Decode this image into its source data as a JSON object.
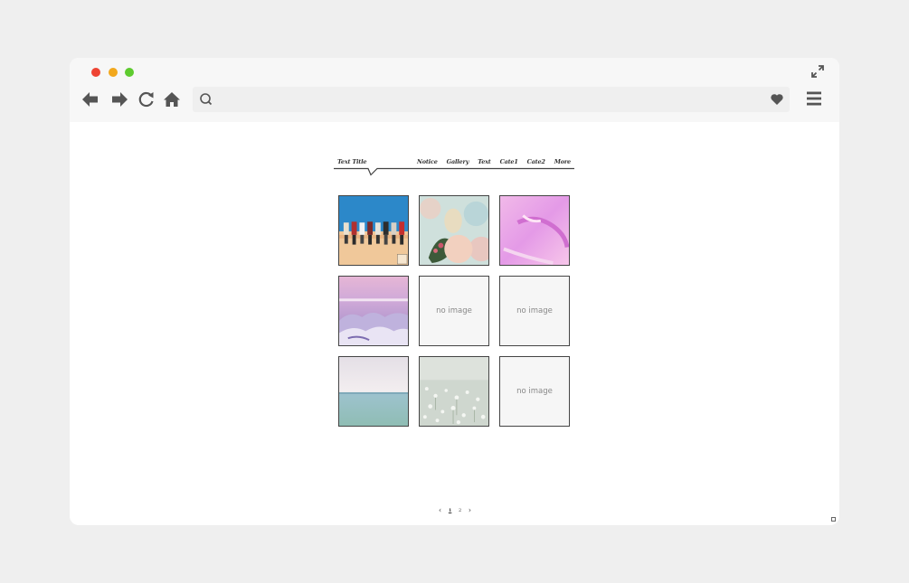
{
  "browser": {
    "window_controls": [
      "close",
      "minimize",
      "zoom"
    ],
    "nav_icons": [
      "back-arrow-icon",
      "forward-arrow-icon",
      "reload-icon",
      "home-icon"
    ],
    "search_icon": "search-icon",
    "favorite_icon": "heart-icon",
    "menu_icon": "hamburger-menu-icon",
    "expand_icon": "expand-icon",
    "colors": {
      "close": "#ee4433",
      "minimize": "#f2a81d",
      "zoom": "#5ecb2f"
    }
  },
  "blog": {
    "title": "Text Title",
    "menu": [
      "Notice",
      "Gallery",
      "Text",
      "Cate1",
      "Cate2",
      "More"
    ]
  },
  "gallery": {
    "tiles": [
      {
        "kind": "image",
        "label": ""
      },
      {
        "kind": "image",
        "label": ""
      },
      {
        "kind": "image",
        "label": ""
      },
      {
        "kind": "image",
        "label": ""
      },
      {
        "kind": "placeholder",
        "label": "no image"
      },
      {
        "kind": "placeholder",
        "label": "no image"
      },
      {
        "kind": "image",
        "label": ""
      },
      {
        "kind": "image",
        "label": ""
      },
      {
        "kind": "placeholder",
        "label": "no image"
      }
    ]
  },
  "pagination": {
    "prev": "‹",
    "pages": [
      "1",
      "2"
    ],
    "current": "1",
    "next": "›"
  }
}
